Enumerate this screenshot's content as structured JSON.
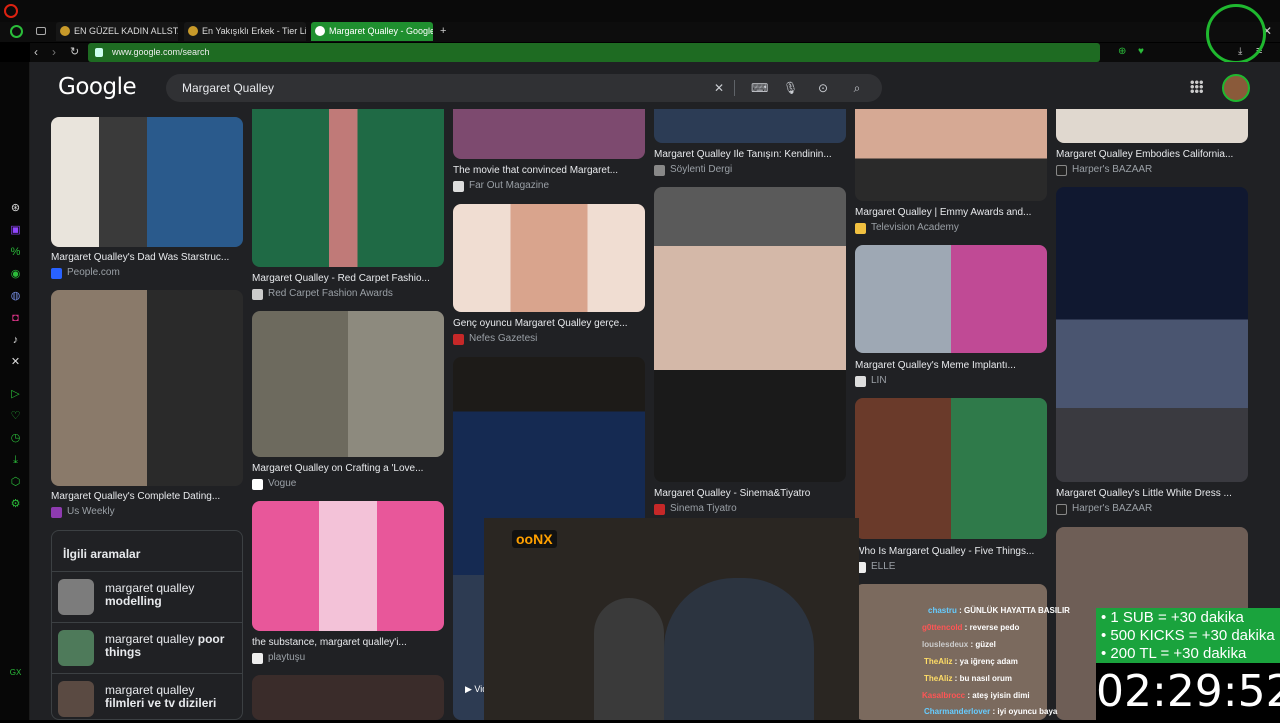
{
  "browser": {
    "tabs": [
      {
        "label": "EN GÜZEL KADIN ALLSTAR"
      },
      {
        "label": "En Yakışıklı Erkek - Tier Lis"
      },
      {
        "label": "Margaret Qualley - Google"
      }
    ],
    "new_tab_label": "+",
    "url": "www.google.com/search"
  },
  "google": {
    "logo": "Google",
    "query": "Margaret Qualley"
  },
  "cards": [
    {
      "title": "Margaret Qualley's Dad Was Starstruc...",
      "source": "People.com"
    },
    {
      "title": "Margaret Qualley's Complete Dating...",
      "source": "Us Weekly"
    },
    {
      "title": "Margaret Qualley - Red Carpet Fashio...",
      "source": "Red Carpet Fashion Awards"
    },
    {
      "title": "Margaret Qualley on Crafting a 'Love...",
      "source": "Vogue"
    },
    {
      "title": "the substance, margaret qualley'i...",
      "source": "playtuşu"
    },
    {
      "title": "The movie that convinced Margaret...",
      "source": "Far Out Magazine"
    },
    {
      "title": "Genç oyuncu Margaret Qualley gerçe...",
      "source": "Nefes Gazetesi"
    },
    {
      "title": "Margaret Qualley İle Tanışın: Kendinin...",
      "source": "Söylenti Dergi"
    },
    {
      "title": "Margaret Qualley - Sinema&Tiyatro",
      "source": "Sinema Tiyatro"
    },
    {
      "title": "Margaret Qualley | Emmy Awards and...",
      "source": "Television Academy"
    },
    {
      "title": "Margaret Qualley's Meme Implantı...",
      "source": "LIN"
    },
    {
      "title": "Who Is Margaret Qualley - Five Things...",
      "source": "ELLE"
    },
    {
      "title": "Margaret Qualley Embodies California...",
      "source": "Harper's BAZAAR"
    },
    {
      "title": "Margaret Qualley's Little White Dress ...",
      "source": "Harper's BAZAAR"
    }
  ],
  "video_label": "Video",
  "related": {
    "heading": "İlgili aramalar",
    "items": [
      {
        "prefix": "margaret qualley",
        "bold": "modelling"
      },
      {
        "prefix": "margaret qualley",
        "bold": "poor things"
      },
      {
        "prefix": "margaret qualley",
        "bold": "filmleri ve tv dizileri"
      }
    ]
  },
  "overlay": {
    "sub_lines": [
      "• 1 SUB = +30 dakika",
      "• 500 KICKS = +30 dakika",
      "• 200 TL = +30 dakika"
    ],
    "timer": "02:29:52",
    "chat": [
      {
        "user": "chastru",
        "msg": "GÜNLÜK HAYATTA BASILIR"
      },
      {
        "user": "g0ttencold",
        "msg": "reverse pedo"
      },
      {
        "user": "louslesdeux",
        "msg": "güzel"
      },
      {
        "user": "TheAliz",
        "msg": "ya iğrenç adam"
      },
      {
        "user": "TheAliz",
        "msg": "bu nasıl orum"
      },
      {
        "user": "Kasalbrocc",
        "msg": "ateş iyisin dimi"
      },
      {
        "user": "Charmanderlover",
        "msg": "iyi oyuncu baya"
      }
    ],
    "brand": "ooNX"
  },
  "colors": {
    "accent": "#1f8f2f",
    "page_bg": "#202124",
    "timer_box": "#1aa33d"
  }
}
